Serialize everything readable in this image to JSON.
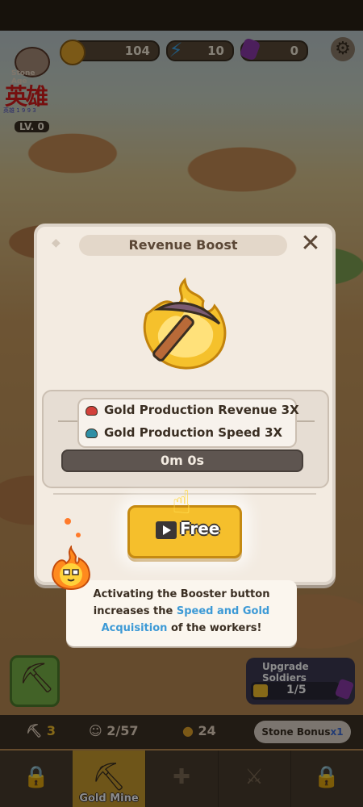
{
  "topbar": {
    "gold": "104",
    "energy": "10",
    "gems": "0"
  },
  "logo": {
    "tagline": "Stone Age",
    "title": "英雄",
    "subtitle": "英雄 1 9 9 3",
    "level": "LV. 0"
  },
  "modal": {
    "title": "Revenue Boost",
    "perks": [
      {
        "label": "Gold Production Revenue 3X",
        "color": "#d2403a"
      },
      {
        "label": "Gold Production Speed 3X",
        "color": "#2f8fa5"
      }
    ],
    "timer": "0m 0s",
    "free_button": "Free"
  },
  "tip": {
    "line1": "Activating the Booster button",
    "line2_prefix": "increases the ",
    "line2_highlight": "Speed and Gold",
    "line3_highlight": "Acquisition",
    "line3_suffix": " of the workers!"
  },
  "upgrade": {
    "title": "Upgrade Soldiers",
    "progress": "1/5"
  },
  "stats": {
    "pickaxe_count": "3",
    "workers": "2/57",
    "coins": "24",
    "stone_bonus_label": "Stone Bonus",
    "stone_bonus_mult": "x1"
  },
  "tabs": [
    {
      "name": "",
      "icon": "lock-icon"
    },
    {
      "name": "Gold Mine",
      "icon": "pickaxe-icon"
    },
    {
      "name": "",
      "icon": "scarecrow-icon"
    },
    {
      "name": "",
      "icon": "crossed-swords-icon"
    },
    {
      "name": "",
      "icon": "lock-icon"
    }
  ],
  "colors": {
    "accent": "#f5bf2c",
    "highlight": "#3d9ad6",
    "modal_bg": "#f3ebe1"
  }
}
